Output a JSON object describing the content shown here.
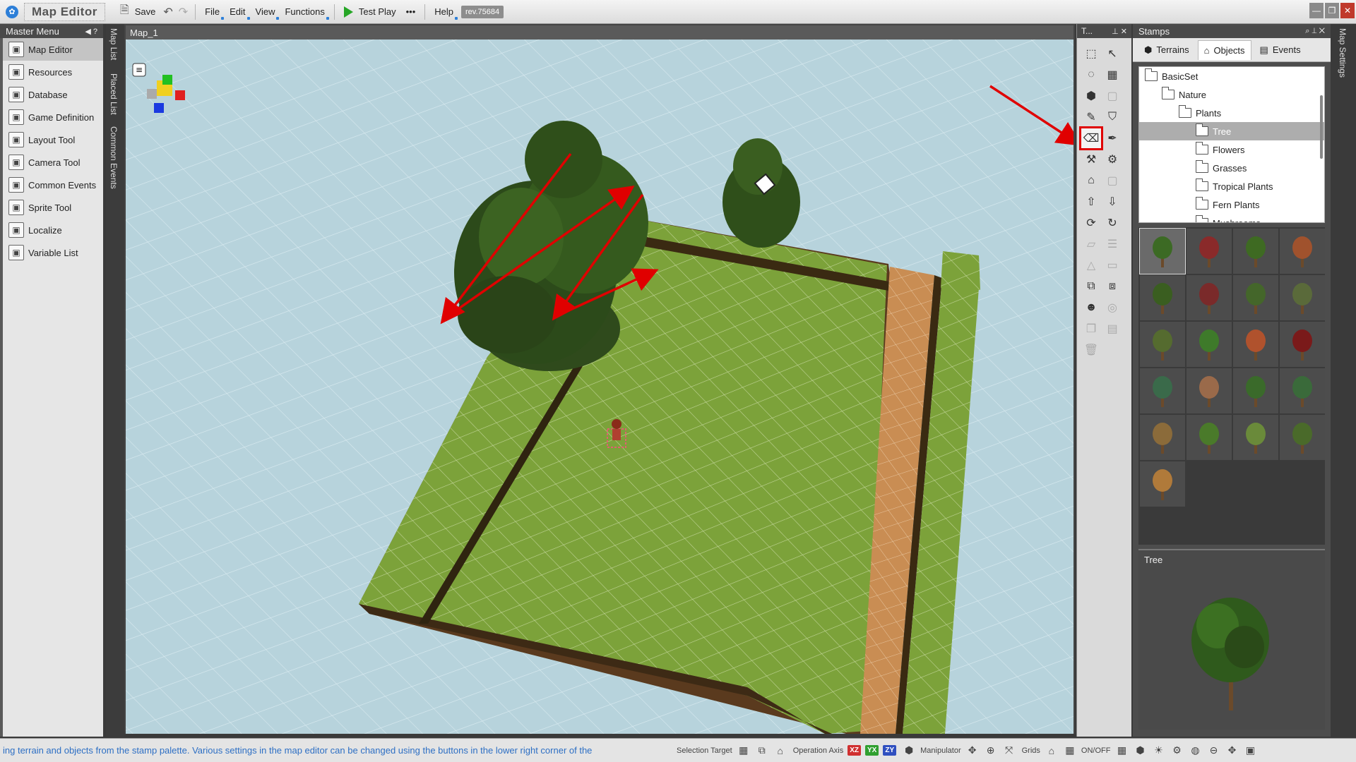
{
  "app": {
    "title": "Map Editor",
    "revision": "rev.75684"
  },
  "toolbar": {
    "save_label": "Save",
    "menus": [
      "File",
      "Edit",
      "View",
      "Functions"
    ],
    "test_play_label": "Test Play",
    "more_label": "•••",
    "help_label": "Help"
  },
  "master_menu": {
    "title": "Master Menu",
    "items": [
      {
        "label": "Map Editor",
        "icon": "map-icon"
      },
      {
        "label": "Resources",
        "icon": "resources-icon"
      },
      {
        "label": "Database",
        "icon": "database-icon"
      },
      {
        "label": "Game Definition",
        "icon": "game-definition-icon"
      },
      {
        "label": "Layout Tool",
        "icon": "layout-icon"
      },
      {
        "label": "Camera Tool",
        "icon": "camera-icon"
      },
      {
        "label": "Common Events",
        "icon": "common-events-icon"
      },
      {
        "label": "Sprite Tool",
        "icon": "sprite-icon"
      },
      {
        "label": "Localize",
        "icon": "localize-icon"
      },
      {
        "label": "Variable List",
        "icon": "variable-list-icon"
      }
    ]
  },
  "side_tabs": [
    "Map List",
    "Placed List",
    "Common Events"
  ],
  "viewport": {
    "tab_label": "Map_1"
  },
  "tools_panel": {
    "title": "T..."
  },
  "stamps": {
    "title": "Stamps",
    "tabs": [
      "Terrains",
      "Objects",
      "Events"
    ],
    "tree": [
      {
        "label": "BasicSet",
        "level": 0
      },
      {
        "label": "Nature",
        "level": 1
      },
      {
        "label": "Plants",
        "level": 2
      },
      {
        "label": "Tree",
        "level": 3,
        "selected": true
      },
      {
        "label": "Flowers",
        "level": 3
      },
      {
        "label": "Grasses",
        "level": 3
      },
      {
        "label": "Tropical Plants",
        "level": 3
      },
      {
        "label": "Fern Plants",
        "level": 3
      },
      {
        "label": "Mushrooms",
        "level": 3
      }
    ],
    "preview_title": "Tree"
  },
  "right_tab": "Map Settings",
  "status": {
    "message": "ing terrain and objects from the stamp palette.  Various settings in the map editor can be changed using the buttons in the lower right corner of the",
    "selection_target_label": "Selection Target",
    "operation_axis_label": "Operation Axis",
    "axes": [
      "XZ",
      "YX",
      "ZY"
    ],
    "manipulator_label": "Manipulator",
    "grids_label": "Grids",
    "onoff_label": "ON/OFF"
  },
  "colors": {
    "accent": "#2d7fd8",
    "highlight": "#e00000",
    "grass": "#7ca23a",
    "path": "#c98d53",
    "sky": "#b7d3dc"
  }
}
